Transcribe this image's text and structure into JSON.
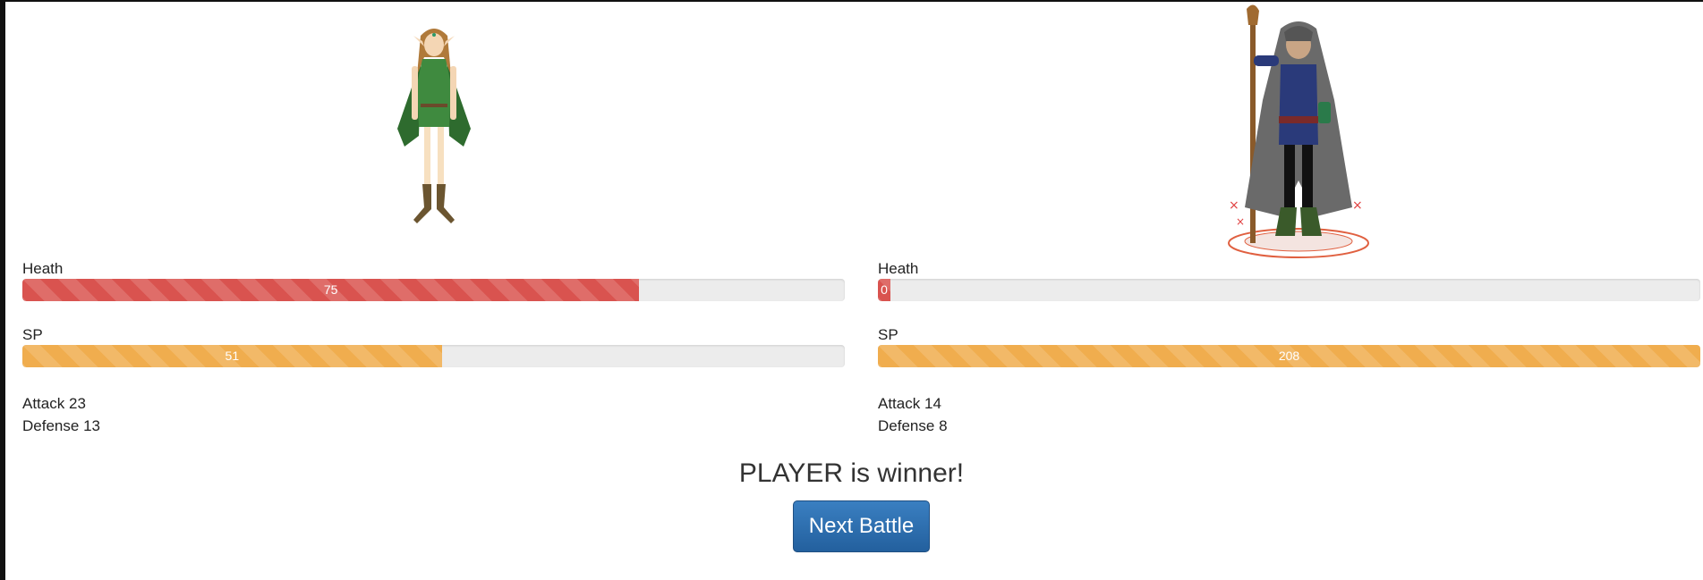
{
  "player": {
    "health_label": "Heath",
    "health_value": 75,
    "sp_label": "SP",
    "sp_value": 51,
    "attack_label": "Attack",
    "attack_value": 23,
    "defense_label": "Defense",
    "defense_value": 13,
    "health_fill_fraction": 0.75,
    "sp_fill_fraction": 0.51
  },
  "enemy": {
    "health_label": "Heath",
    "health_value": 0,
    "sp_label": "SP",
    "sp_value": 208,
    "attack_label": "Attack",
    "attack_value": 14,
    "defense_label": "Defense",
    "defense_value": 8,
    "health_fill_fraction": 0.0,
    "sp_fill_fraction": 1.0
  },
  "result_text": "PLAYER is winner!",
  "next_button_label": "Next Battle",
  "colors": {
    "health": "#d9534f",
    "sp": "#f0ad4e",
    "button": "#286090"
  },
  "icons": {
    "player_avatar": "elf-archer-icon",
    "enemy_avatar": "hooded-wizard-icon"
  }
}
